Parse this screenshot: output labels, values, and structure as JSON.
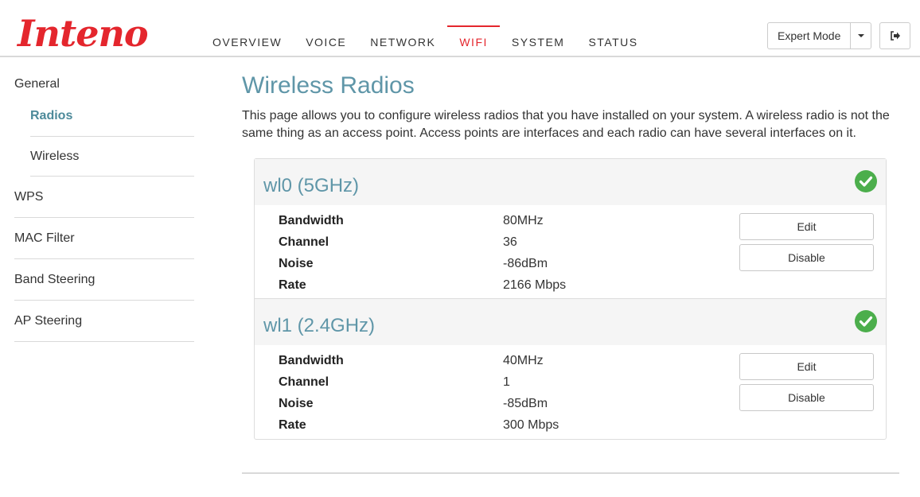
{
  "brand": {
    "logo_text": "Inteno",
    "accent": "#e4262d",
    "title_color": "#5f96a8"
  },
  "nav": {
    "items": [
      {
        "label": "OVERVIEW"
      },
      {
        "label": "VOICE"
      },
      {
        "label": "NETWORK"
      },
      {
        "label": "WIFI",
        "active": true
      },
      {
        "label": "SYSTEM"
      },
      {
        "label": "STATUS"
      }
    ]
  },
  "mode": {
    "label": "Expert Mode",
    "caret_icon": "caret-down-icon"
  },
  "logout": {
    "icon": "logout-icon"
  },
  "sidebar": {
    "general": "General",
    "general_sub": [
      {
        "label": "Radios",
        "active": true
      },
      {
        "label": "Wireless"
      }
    ],
    "items": [
      {
        "label": "WPS"
      },
      {
        "label": "MAC Filter"
      },
      {
        "label": "Band Steering"
      },
      {
        "label": "AP Steering"
      }
    ]
  },
  "main": {
    "title": "Wireless Radios",
    "description": "This page allows you to configure wireless radios that you have installed on your system. A wireless radio is not the same thing as an access point. Access points are interfaces and each radio can have several interfaces on it."
  },
  "radios": [
    {
      "name": "wl0 (5GHz)",
      "status_icon": "check-circle-icon",
      "status_color": "#4cae4c",
      "rows": [
        {
          "label": "Bandwidth",
          "value": "80MHz"
        },
        {
          "label": "Channel",
          "value": "36"
        },
        {
          "label": "Noise",
          "value": "-86dBm"
        },
        {
          "label": "Rate",
          "value": "2166 Mbps"
        }
      ],
      "edit_label": "Edit",
      "disable_label": "Disable"
    },
    {
      "name": "wl1 (2.4GHz)",
      "status_icon": "check-circle-icon",
      "status_color": "#4cae4c",
      "rows": [
        {
          "label": "Bandwidth",
          "value": "40MHz"
        },
        {
          "label": "Channel",
          "value": "1"
        },
        {
          "label": "Noise",
          "value": "-85dBm"
        },
        {
          "label": "Rate",
          "value": "300 Mbps"
        }
      ],
      "edit_label": "Edit",
      "disable_label": "Disable"
    }
  ]
}
